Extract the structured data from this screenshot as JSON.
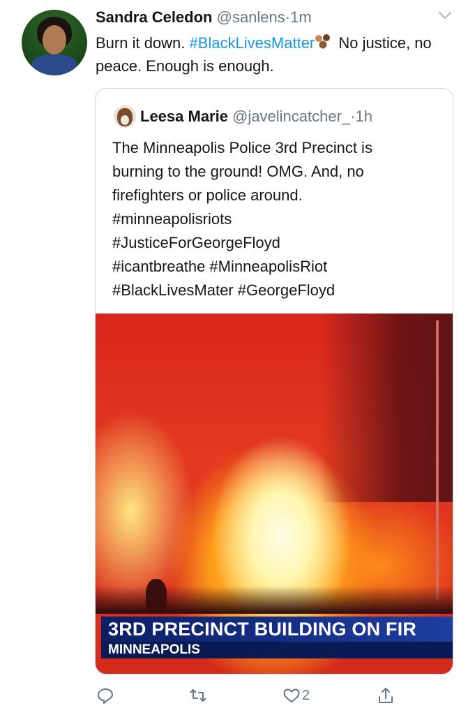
{
  "tweet": {
    "author_name": "Sandra Celedon",
    "author_handle": "@sanlens",
    "separator": "·",
    "time": "1m",
    "text_part1": "Burn it down. ",
    "hashtag": "#BlackLivesMatter",
    "text_part2": " No justice, no peace. Enough is enough."
  },
  "quoted": {
    "author_name": "Leesa Marie",
    "author_handle": "@javelincatcher_",
    "separator": "·",
    "time": "1h",
    "lines": [
      "The Minneapolis Police 3rd Precinct is",
      "burning to the ground! OMG.  And, no",
      "firefighters or police around.",
      "#minneapolisriots",
      "#JusticeForGeorgeFloyd",
      "#icantbreathe #MinneapolisRiot",
      "#BlackLivesMater #GeorgeFloyd"
    ],
    "media": {
      "chyron_line1": "3RD PRECINCT BUILDING ON FIR",
      "chyron_line2": "MINNEAPOLIS"
    }
  },
  "actions": {
    "reply_icon": "reply-icon",
    "retweet_icon": "retweet-icon",
    "like_icon": "like-icon",
    "like_count": "2",
    "share_icon": "share-icon"
  },
  "colors": {
    "link": "#1b95e0",
    "muted": "#657786",
    "border": "#ccd6dd"
  }
}
